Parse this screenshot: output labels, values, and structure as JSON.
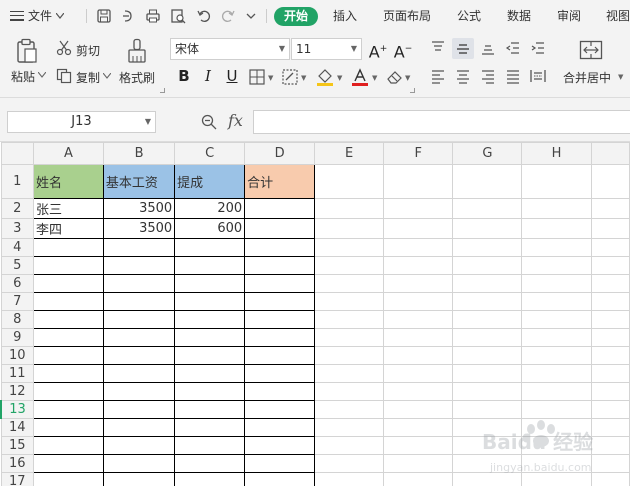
{
  "menubar": {
    "file_label": "文件",
    "tabs": [
      {
        "label": "开始",
        "active": true
      },
      {
        "label": "插入",
        "active": false
      },
      {
        "label": "页面布局",
        "active": false
      },
      {
        "label": "公式",
        "active": false
      },
      {
        "label": "数据",
        "active": false
      },
      {
        "label": "审阅",
        "active": false
      },
      {
        "label": "视图",
        "active": false
      }
    ]
  },
  "ribbon": {
    "paste_label": "粘贴",
    "cut_label": "剪切",
    "copy_label": "复制",
    "format_painter_label": "格式刷",
    "font_name": "宋体",
    "font_size": "11",
    "merge_label": "合并居中"
  },
  "formula_bar": {
    "name_box": "J13",
    "fx_label": "fx",
    "formula": ""
  },
  "sheet": {
    "columns": [
      "A",
      "B",
      "C",
      "D",
      "E",
      "F",
      "G",
      "H"
    ],
    "row_numbers": [
      "1",
      "2",
      "3",
      "4",
      "5",
      "6",
      "7",
      "8",
      "9",
      "10",
      "11",
      "12",
      "13",
      "14",
      "15",
      "16",
      "17"
    ],
    "selected_row": "13",
    "header_row": [
      "姓名",
      "基本工资",
      "提成",
      "合计"
    ],
    "rows": [
      [
        "张三",
        "3500",
        "200",
        ""
      ],
      [
        "李四",
        "3500",
        "600",
        ""
      ]
    ],
    "header_colors": {
      "A": "#a9d08e",
      "B": "#9bc2e6",
      "C": "#9bc2e6",
      "D": "#f8cbad"
    }
  },
  "watermark": {
    "text": "Baidu 经验",
    "subtext": "jingyan.baidu.com"
  }
}
